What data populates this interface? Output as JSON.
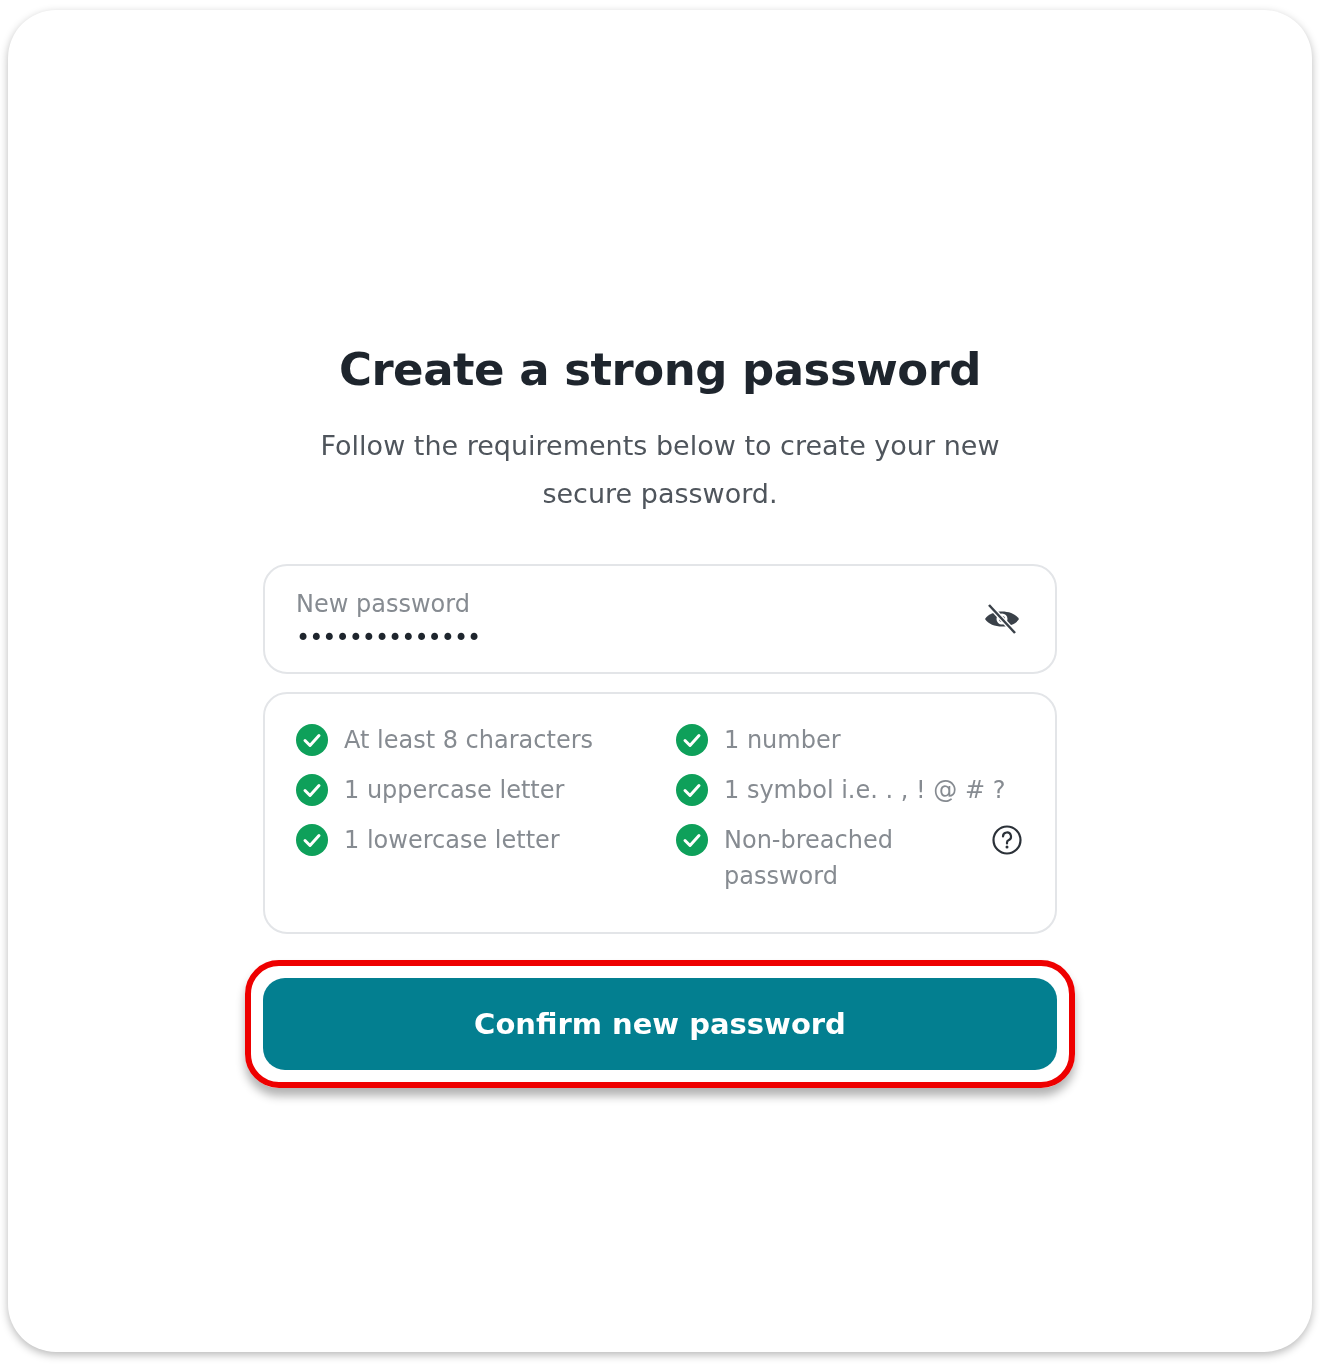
{
  "title": "Create a strong password",
  "subtitle": "Follow the requirements below to create your new secure password.",
  "password_field": {
    "label": "New password",
    "value": "••••••••••••••",
    "revealed": false
  },
  "requirements": [
    {
      "text": "At least 8 characters",
      "met": true,
      "help": false
    },
    {
      "text": "1 uppercase letter",
      "met": true,
      "help": false
    },
    {
      "text": "1 lowercase letter",
      "met": true,
      "help": false
    },
    {
      "text": "1 number",
      "met": true,
      "help": false
    },
    {
      "text": "1 symbol i.e. . , ! @ # ?",
      "met": true,
      "help": false
    },
    {
      "text": "Non-breached password",
      "met": true,
      "help": true
    }
  ],
  "confirm_button": {
    "label": "Confirm new password",
    "highlighted": true
  }
}
